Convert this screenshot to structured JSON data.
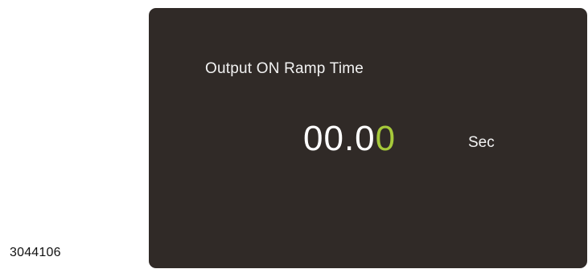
{
  "figure_id": "3044106",
  "screen": {
    "title": "Output ON Ramp Time",
    "value_main": "00.0",
    "value_cursor_digit": "0",
    "unit": "Sec"
  },
  "colors": {
    "screen_background": "#302a27",
    "text": "#f2f2f2",
    "cursor_digit": "#a6c93a"
  }
}
